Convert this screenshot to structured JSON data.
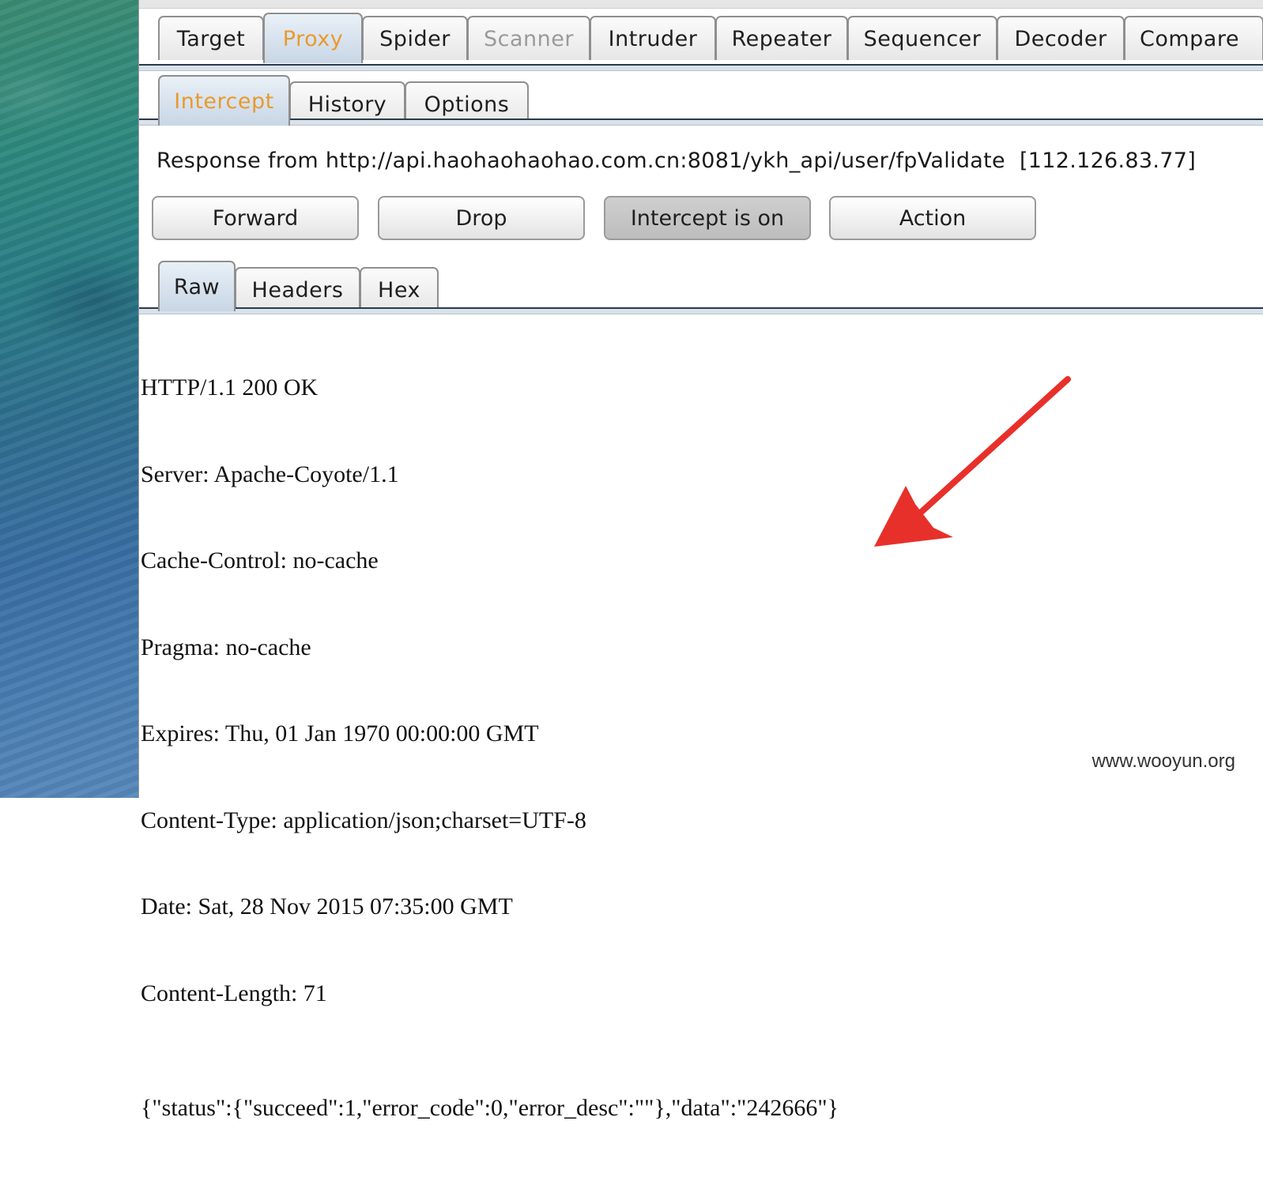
{
  "main_tabs": [
    {
      "label": "Target",
      "state": "normal"
    },
    {
      "label": "Proxy",
      "state": "active"
    },
    {
      "label": "Spider",
      "state": "normal"
    },
    {
      "label": "Scanner",
      "state": "disabled"
    },
    {
      "label": "Intruder",
      "state": "normal"
    },
    {
      "label": "Repeater",
      "state": "normal"
    },
    {
      "label": "Sequencer",
      "state": "normal"
    },
    {
      "label": "Decoder",
      "state": "normal"
    },
    {
      "label": "Compare",
      "state": "normal"
    }
  ],
  "sub_tabs": [
    {
      "label": "Intercept",
      "state": "active"
    },
    {
      "label": "History",
      "state": "normal"
    },
    {
      "label": "Options",
      "state": "normal"
    }
  ],
  "response": {
    "text": "Response from http://api.haohaohaohao.com.cn:8081/ykh_api/user/fpValidate",
    "ip": "[112.126.83.77]"
  },
  "buttons": {
    "forward": "Forward",
    "drop": "Drop",
    "intercept": "Intercept is on",
    "action": "Action"
  },
  "view_tabs": [
    {
      "label": "Raw",
      "state": "active"
    },
    {
      "label": "Headers",
      "state": "normal"
    },
    {
      "label": "Hex",
      "state": "normal"
    }
  ],
  "raw": {
    "headers": [
      "HTTP/1.1 200 OK",
      "Server: Apache-Coyote/1.1",
      "Cache-Control: no-cache",
      "Pragma: no-cache",
      "Expires: Thu, 01 Jan 1970 00:00:00 GMT",
      "Content-Type: application/json;charset=UTF-8",
      "Date: Sat, 28 Nov 2015 07:35:00 GMT",
      "Content-Length: 71"
    ],
    "body": "{\"status\":{\"succeed\":1,\"error_code\":0,\"error_desc\":\"\"},\"data\":\"242666\"}"
  },
  "colors": {
    "active_tab_text": "#e89a2e",
    "arrow": "#e8302a"
  },
  "watermark": "www.wooyun.org"
}
